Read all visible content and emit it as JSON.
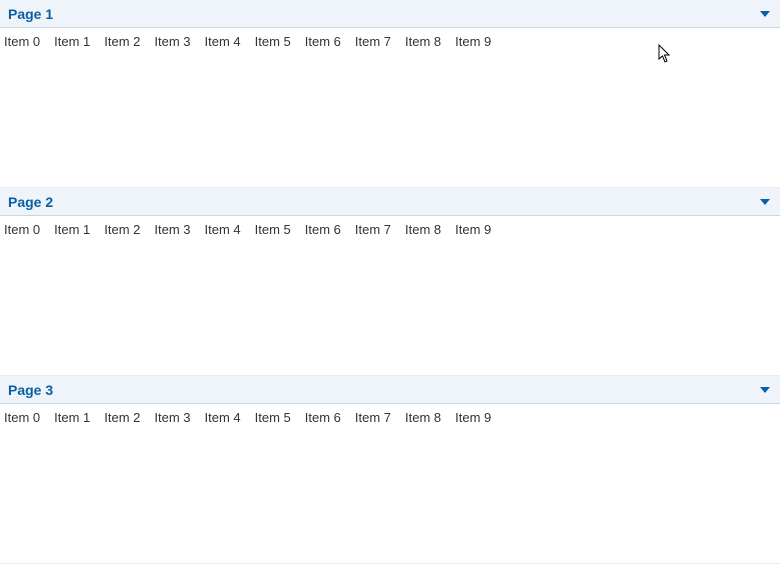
{
  "panels": [
    {
      "title": "Page 1",
      "items": [
        "Item 0",
        "Item 1",
        "Item 2",
        "Item 3",
        "Item 4",
        "Item 5",
        "Item 6",
        "Item 7",
        "Item 8",
        "Item 9"
      ]
    },
    {
      "title": "Page 2",
      "items": [
        "Item 0",
        "Item 1",
        "Item 2",
        "Item 3",
        "Item 4",
        "Item 5",
        "Item 6",
        "Item 7",
        "Item 8",
        "Item 9"
      ]
    },
    {
      "title": "Page 3",
      "items": [
        "Item 0",
        "Item 1",
        "Item 2",
        "Item 3",
        "Item 4",
        "Item 5",
        "Item 6",
        "Item 7",
        "Item 8",
        "Item 9"
      ]
    }
  ],
  "colors": {
    "header_bg": "#eef4fa",
    "title": "#0b5fa5",
    "arrow": "#0b5fa5"
  }
}
